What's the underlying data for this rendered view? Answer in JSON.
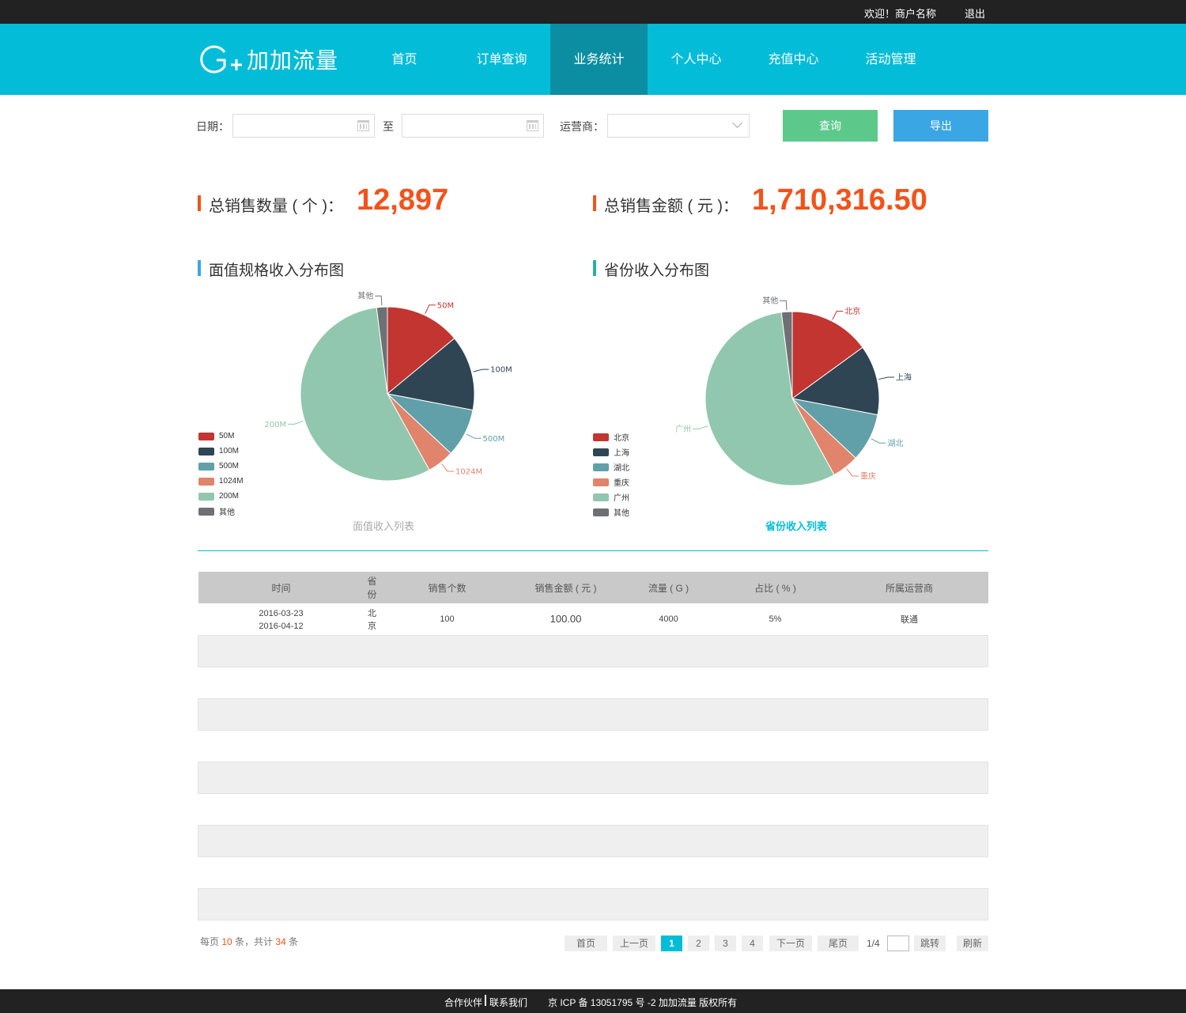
{
  "topbar": {
    "welcome": "欢迎！商户名称",
    "logout": "退出"
  },
  "header": {
    "logo_text": "加加流量",
    "nav": [
      {
        "label": "首页"
      },
      {
        "label": "订单查询"
      },
      {
        "label": "业务统计",
        "active": true
      },
      {
        "label": "个人中心"
      },
      {
        "label": "充值中心"
      },
      {
        "label": "活动管理"
      }
    ]
  },
  "filters": {
    "date_label": "日期：",
    "to_label": "至",
    "operator_label": "运营商：",
    "start_date": "",
    "end_date": "",
    "operator_value": "",
    "query_button": "查询",
    "export_button": "导出"
  },
  "stats": {
    "total_count_label": "总销售数量 ( 个 )：",
    "total_count_value": "12,897",
    "total_amount_label": "总销售金额 ( 元 )：",
    "total_amount_value": "1,710,316.50"
  },
  "colors": {
    "primary": "#03bcd8",
    "nav_active": "#0b8ea2",
    "accent_orange": "#f2531b",
    "query_green": "#5cc98b",
    "export_blue": "#3aa6e3"
  },
  "chart_data": [
    {
      "type": "pie",
      "title": "面值规格收入分布图",
      "legend_position": "bottom-left",
      "slices": [
        {
          "label": "50M",
          "value": 14,
          "color": "#c23531"
        },
        {
          "label": "100M",
          "value": 14,
          "color": "#2f4554"
        },
        {
          "label": "500M",
          "value": 9,
          "color": "#61a0a8"
        },
        {
          "label": "1024M",
          "value": 5,
          "color": "#e0846b"
        },
        {
          "label": "200M",
          "value": 56,
          "color": "#91c7ae"
        },
        {
          "label": "其他",
          "value": 2,
          "color": "#6e7074"
        }
      ],
      "link_text": "面值收入列表"
    },
    {
      "type": "pie",
      "title": "省份收入分布图",
      "legend_position": "bottom-left",
      "slices": [
        {
          "label": "北京",
          "value": 15,
          "color": "#c23531"
        },
        {
          "label": "上海",
          "value": 13,
          "color": "#2f4554"
        },
        {
          "label": "湖北",
          "value": 9,
          "color": "#61a0a8"
        },
        {
          "label": "重庆",
          "value": 5,
          "color": "#e0846b"
        },
        {
          "label": "广州",
          "value": 56,
          "color": "#91c7ae"
        },
        {
          "label": "其他",
          "value": 2,
          "color": "#6e7074"
        }
      ],
      "link_text": "省份收入列表"
    }
  ],
  "table": {
    "headers": [
      "时间",
      "省份",
      "销售个数",
      "销售金额 ( 元 )",
      "流量 ( G )",
      "占比 ( % )",
      "所属运营商"
    ],
    "rows": [
      {
        "time_start": "2016-03-23",
        "time_end": "2016-04-12",
        "province": "北京",
        "count": "100",
        "amount": "100.00",
        "traffic": "4000",
        "ratio": "5%",
        "operator": "联通"
      }
    ],
    "empty_rows": 9
  },
  "pagination": {
    "per_page_prefix": "每页",
    "per_page": "10",
    "per_page_suffix": "条，共计",
    "total": "34",
    "total_suffix": "条",
    "first": "首页",
    "prev": "上一页",
    "pages": [
      "1",
      "2",
      "3",
      "4"
    ],
    "current": "1",
    "next": "下一页",
    "last": "尾页",
    "fraction": "1/4",
    "goto_value": "",
    "jump": "跳转",
    "refresh": "刷新"
  },
  "footer": {
    "partners": "合作伙伴",
    "contact": "联系我们",
    "icp": "京 ICP 备 13051795 号 -2 加加流量  版权所有"
  }
}
